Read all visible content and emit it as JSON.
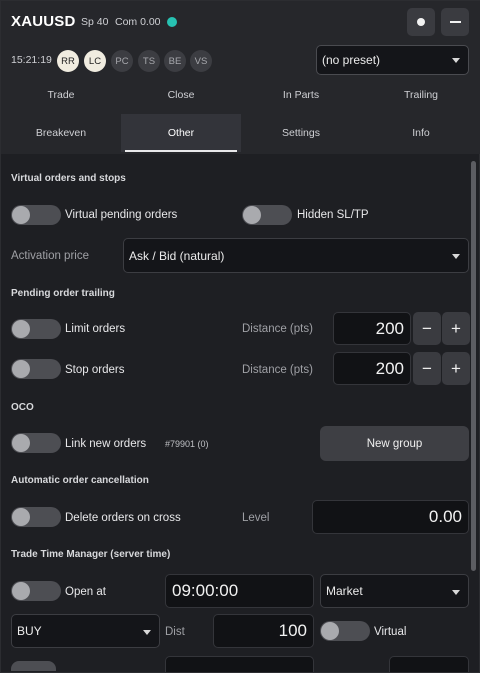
{
  "header": {
    "symbol": "XAUUSD",
    "spread": "Sp 40",
    "commission": "Com 0.00",
    "status_color": "#27c2b2",
    "time": "15:21:19",
    "chips": [
      {
        "label": "RR",
        "active": true
      },
      {
        "label": "LC",
        "active": true
      },
      {
        "label": "PC",
        "active": false
      },
      {
        "label": "TS",
        "active": false
      },
      {
        "label": "BE",
        "active": false
      },
      {
        "label": "VS",
        "active": false
      }
    ],
    "preset": "(no preset)"
  },
  "tabs": {
    "row1": [
      "Trade",
      "Close",
      "In Parts",
      "Trailing"
    ],
    "row2": [
      "Breakeven",
      "Other",
      "Settings",
      "Info"
    ],
    "active": "Other"
  },
  "virtual": {
    "title": "Virtual orders and stops",
    "pending_label": "Virtual pending orders",
    "hidden_label": "Hidden SL/TP",
    "activation_label": "Activation price",
    "activation_value": "Ask / Bid (natural)"
  },
  "trailing": {
    "title": "Pending order trailing",
    "limit_label": "Limit orders",
    "stop_label": "Stop orders",
    "distance_label": "Distance (pts)",
    "limit_distance": "200",
    "stop_distance": "200",
    "minus": "−",
    "plus": "+"
  },
  "oco": {
    "title": "OCO",
    "link_label": "Link new orders",
    "group_id": "#79901 (0)",
    "new_group": "New group"
  },
  "cancel": {
    "title": "Automatic order cancellation",
    "delete_label": "Delete orders on cross",
    "level_label": "Level",
    "level_value": "0.00"
  },
  "ttm": {
    "title": "Trade Time Manager (server time)",
    "open_label": "Open at",
    "time_value": "09:00:00",
    "order_type": "Market",
    "direction": "BUY",
    "dist_label": "Dist",
    "dist_value": "100",
    "virtual_label": "Virtual"
  }
}
